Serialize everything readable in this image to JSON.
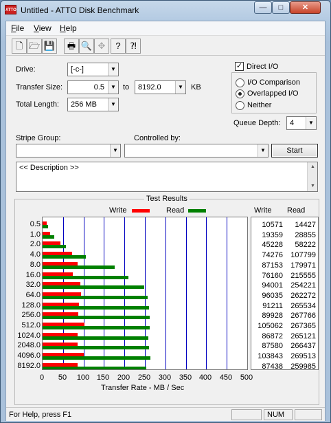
{
  "window": {
    "title": "Untitled - ATTO Disk Benchmark",
    "app_icon_text": "ATTO",
    "buttons": {
      "minimize": "—",
      "maximize": "□",
      "close": "✕"
    }
  },
  "menu": {
    "file": "File",
    "view": "View",
    "help": "Help"
  },
  "toolbar": [
    "new-icon",
    "open-icon",
    "save-icon",
    "print-icon",
    "print-preview-icon",
    "move-icon",
    "help-icon",
    "context-help-icon"
  ],
  "form": {
    "drive_label": "Drive:",
    "drive_value": "[-c-]",
    "transfer_size_label": "Transfer Size:",
    "transfer_from": "0.5",
    "to_label": "to",
    "transfer_to": "8192.0",
    "kb_label": "KB",
    "total_length_label": "Total Length:",
    "total_length_value": "256 MB",
    "direct_io_label": "Direct I/O",
    "direct_io_checked": true,
    "io_comparison_label": "I/O Comparison",
    "overlapped_io_label": "Overlapped I/O",
    "neither_label": "Neither",
    "selected_mode": "overlapped",
    "queue_depth_label": "Queue Depth:",
    "queue_depth_value": "4",
    "stripe_group_label": "Stripe Group:",
    "stripe_group_value": "",
    "controlled_by_label": "Controlled by:",
    "controlled_by_value": "",
    "start_label": "Start",
    "description": "<< Description >>"
  },
  "results": {
    "title": "Test Results",
    "legend_write": "Write",
    "legend_read": "Read",
    "col_write": "Write",
    "col_read": "Read",
    "rows": [
      {
        "size": "0.5",
        "write": "10571",
        "read": "14427"
      },
      {
        "size": "1.0",
        "write": "19359",
        "read": "28855"
      },
      {
        "size": "2.0",
        "write": "45228",
        "read": "58222"
      },
      {
        "size": "4.0",
        "write": "74276",
        "read": "107799"
      },
      {
        "size": "8.0",
        "write": "87153",
        "read": "179971"
      },
      {
        "size": "16.0",
        "write": "76160",
        "read": "215555"
      },
      {
        "size": "32.0",
        "write": "94001",
        "read": "254221"
      },
      {
        "size": "64.0",
        "write": "96035",
        "read": "262272"
      },
      {
        "size": "128.0",
        "write": "91211",
        "read": "265534"
      },
      {
        "size": "256.0",
        "write": "89928",
        "read": "267766"
      },
      {
        "size": "512.0",
        "write": "105062",
        "read": "267365"
      },
      {
        "size": "1024.0",
        "write": "86872",
        "read": "265121"
      },
      {
        "size": "2048.0",
        "write": "87580",
        "read": "266437"
      },
      {
        "size": "4096.0",
        "write": "103843",
        "read": "269513"
      },
      {
        "size": "8192.0",
        "write": "87438",
        "read": "259985"
      }
    ],
    "x_ticks": [
      "0",
      "50",
      "100",
      "150",
      "200",
      "250",
      "300",
      "350",
      "400",
      "450",
      "500"
    ],
    "x_label": "Transfer Rate - MB / Sec",
    "x_max": 500,
    "write_color": "#ff0000",
    "read_color": "#008000",
    "grid_color": "#0000c0"
  },
  "status": {
    "text": "For Help, press F1",
    "num": "NUM"
  }
}
